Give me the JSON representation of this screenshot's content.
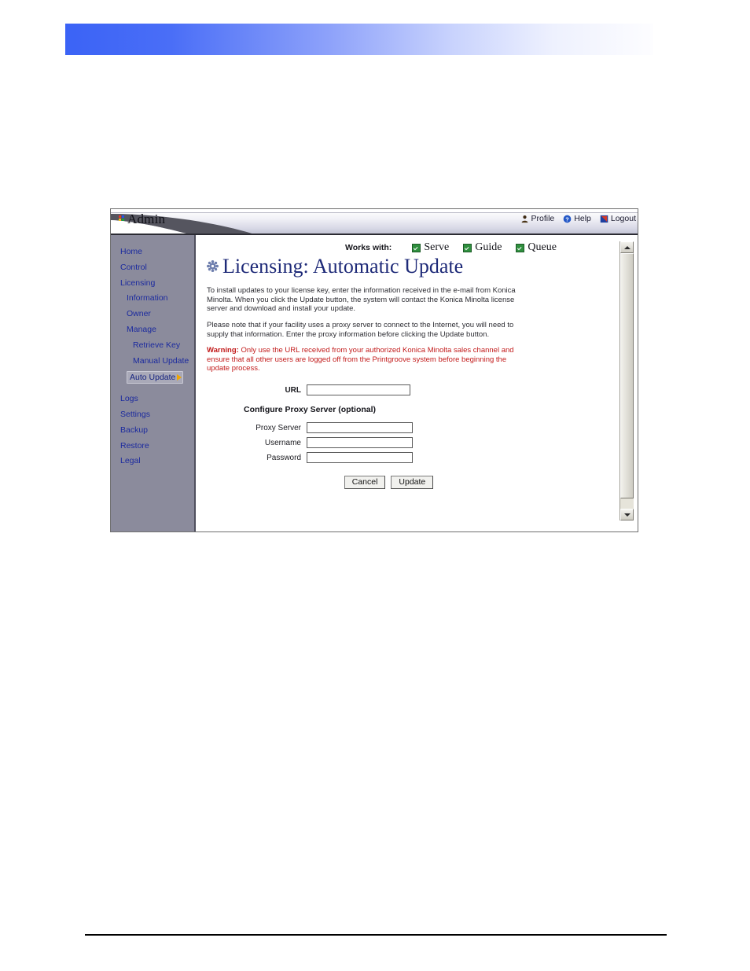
{
  "window": {
    "app_title": "Admin",
    "logo_icon": "four-color-dots-logo"
  },
  "header_tools": [
    {
      "label": "Profile",
      "icon": "person-icon"
    },
    {
      "label": "Help",
      "icon": "help-question-icon"
    },
    {
      "label": "Logout",
      "icon": "logout-icon"
    }
  ],
  "sidebar": {
    "items": [
      {
        "label": "Home",
        "level": 1,
        "active": false
      },
      {
        "label": "Control",
        "level": 1,
        "active": false
      },
      {
        "label": "Licensing",
        "level": 1,
        "active": false
      },
      {
        "label": "Information",
        "level": 2,
        "active": false
      },
      {
        "label": "Owner",
        "level": 2,
        "active": false
      },
      {
        "label": "Manage",
        "level": 2,
        "active": false
      },
      {
        "label": "Retrieve Key",
        "level": 3,
        "active": false
      },
      {
        "label": "Manual Update",
        "level": 3,
        "active": false
      },
      {
        "label": "Auto Update",
        "level": 3,
        "active": true
      },
      {
        "label": "Logs",
        "level": 1,
        "active": false
      },
      {
        "label": "Settings",
        "level": 1,
        "active": false
      },
      {
        "label": "Backup",
        "level": 1,
        "active": false
      },
      {
        "label": "Restore",
        "level": 1,
        "active": false
      },
      {
        "label": "Legal",
        "level": 1,
        "active": false
      }
    ]
  },
  "works_with": {
    "label": "Works with:",
    "items": [
      {
        "label": "Serve",
        "checked": true
      },
      {
        "label": "Guide",
        "checked": true
      },
      {
        "label": "Queue",
        "checked": true
      }
    ],
    "check_color": "#2f8f3e"
  },
  "page": {
    "title": "Licensing: Automatic Update",
    "title_icon": "gear-icon",
    "title_color": "#1e2a78",
    "paragraph_1": "To install updates to your license key, enter the information received in the e-mail from Konica Minolta. When you click the Update button, the system will contact the Konica Minolta license server and download and install your update.",
    "paragraph_2": "Please note that if your facility uses a proxy server to connect to the Internet, you will need to supply that information. Enter the proxy information before clicking the Update button.",
    "warning_prefix": "Warning:",
    "warning_text": " Only use the URL received from your authorized Konica Minolta sales channel and ensure that all other users are logged off from the Printgroove system before beginning the update process.",
    "warning_color": "#c21a1a"
  },
  "form": {
    "url_label": "URL",
    "url_value": "",
    "url_placeholder": "",
    "proxy_section_heading": "Configure Proxy Server (optional)",
    "fields": [
      {
        "label": "Proxy Server",
        "value": "",
        "type": "text"
      },
      {
        "label": "Username",
        "value": "",
        "type": "text"
      },
      {
        "label": "Password",
        "value": "",
        "type": "password"
      }
    ],
    "cancel_label": "Cancel",
    "update_label": "Update"
  },
  "scrollbar": {
    "up_icon": "triangle-up-icon",
    "down_icon": "triangle-down-icon",
    "position": "top"
  }
}
